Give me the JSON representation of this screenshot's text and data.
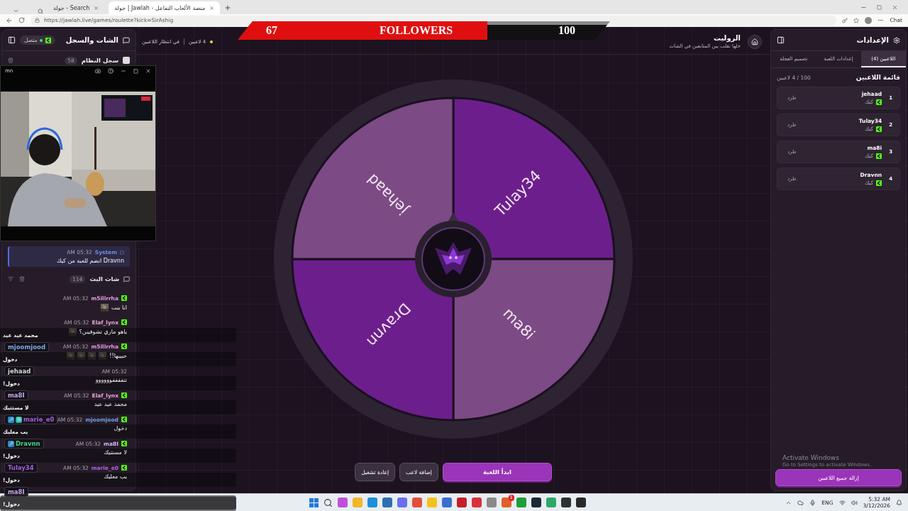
{
  "browser": {
    "tabs": [
      {
        "label": "جولة | Jawlah - منصة الألعاب التفاعل",
        "selected": true
      },
      {
        "label": "جولة - Search",
        "selected": false
      }
    ],
    "url": "https://jawlah.live/games/roulette?kick=SirAshig",
    "chat_button": "Chat"
  },
  "followers_bar": {
    "current": "67",
    "label": "FOLLOWERS",
    "goal": "100",
    "level": 0.67
  },
  "chat_panel": {
    "title": "الشات والسجل",
    "status": "متصل",
    "connected": true,
    "system_log": {
      "title": "سجل النظام",
      "count": "58",
      "messages": [
        {
          "sender": "System",
          "time": "AM 05:32",
          "text": "Dravnn انضم للعبة من كيك"
        }
      ]
    },
    "stream_chat": {
      "title": "شات البث",
      "count": "114",
      "messages": [
        {
          "user": "m5illrrha",
          "color": "#e59be8",
          "time": "AM 05:32",
          "text": "انا بنت"
        },
        {
          "user": "Elaf_lynx",
          "color": "#e7a6d9",
          "time": "AM 05:32",
          "text": "ياهو ماري تشوفينن؟"
        },
        {
          "user": "m5illrrha",
          "color": "#e59be8",
          "time": "AM 05:32",
          "text": "حبيبها!!"
        },
        {
          "time": "AM 05:32",
          "text": "تتففففوووووو"
        },
        {
          "user": "Elaf_lynx",
          "color": "#e7a6d9",
          "time": "AM 05:32",
          "text": "محمد عيد عيد"
        },
        {
          "user": "mjoomjood",
          "color": "#6f9fe0",
          "time": "AM 05:32",
          "text": "دخول"
        },
        {
          "user": "ma8I",
          "color": "#d9b8f5",
          "time": "AM 05:32",
          "text": "لا مستتيك"
        },
        {
          "user": "marie_e0",
          "color": "#b064e6",
          "time": "AM 05:32",
          "text": "يب معليك"
        }
      ]
    }
  },
  "camera_window": {
    "title": "mn",
    "kind": "picture"
  },
  "game": {
    "players_count": "4 لاعبين",
    "status": "في انتظار اللاعبين",
    "title": "الروليت",
    "subtitle": "خلها تقلب بين المتابعين في الشات",
    "wheel": [
      {
        "name": "Tulay34",
        "color": "#6c1f8c"
      },
      {
        "name": "ma8i",
        "color": "#7c4a84"
      },
      {
        "name": "Dravnn",
        "color": "#6c1f8c"
      },
      {
        "name": "jehaad",
        "color": "#7c4a84"
      }
    ],
    "buttons": [
      {
        "label": "ابدأ اللعبة",
        "kind": "primary"
      },
      {
        "label": "إضافة لاعب",
        "kind": "secondary"
      },
      {
        "label": "إعادة تشغيل",
        "kind": "secondary"
      }
    ]
  },
  "settings_panel": {
    "title": "الإعدادات",
    "tabs": [
      {
        "label": "اللاعبين (4)",
        "selected": true
      },
      {
        "label": "إعدادات اللعبة",
        "selected": false
      },
      {
        "label": "تصميم العجلة",
        "selected": false
      }
    ],
    "list_title": "قائمة اللاعبين",
    "list_count": "100 / 4 لاعبين",
    "players": [
      {
        "rank": "1",
        "name": "jehaad",
        "platform": "كيك",
        "action": "طرد"
      },
      {
        "rank": "2",
        "name": "Tulay34",
        "platform": "كيك",
        "action": "طرد"
      },
      {
        "rank": "3",
        "name": "ma8i",
        "platform": "كيك",
        "action": "طرد"
      },
      {
        "rank": "4",
        "name": "Dravnn",
        "platform": "كيك",
        "action": "طرد"
      }
    ],
    "clear_button": "إزالة جميع اللاعبين"
  },
  "os_notice": {
    "title": "Activate Windows",
    "text": "Go to Settings to activate Windows."
  },
  "chat_overlay": [
    {
      "text": "محمد عيد عيد"
    },
    {
      "user": "mjoomjood",
      "color": "#7aa7e6",
      "text": "دخول"
    },
    {
      "user": "jehaad",
      "color": "#d6d6d6",
      "text": "دخول!"
    },
    {
      "user": "ma8I",
      "color": "#c9a6ef",
      "text": "لا مستتيك"
    },
    {
      "user": "marie_e0",
      "color": "#a45de0",
      "badges": [
        {
          "kind": "wrench"
        },
        {
          "kind": "grid"
        }
      ],
      "text": "يب معليك"
    },
    {
      "user": "Dravnn",
      "color": "#45d483",
      "badges": [
        {
          "kind": "wrench"
        }
      ],
      "text": "دخول!"
    },
    {
      "user": "Tulay34",
      "color": "#a45de0",
      "text": "دخول!"
    },
    {
      "user": "ma8I",
      "color": "#c9a6ef",
      "text": "دخول!"
    }
  ],
  "taskbar": {
    "apps": [
      {
        "kind": "start"
      },
      {
        "kind": "search"
      },
      {
        "kind": "app",
        "color": "#c04fd8"
      },
      {
        "kind": "app",
        "color": "#f2b62b"
      },
      {
        "kind": "app",
        "color": "#1f8fd8"
      },
      {
        "kind": "app",
        "color": "#2f6fb0"
      },
      {
        "kind": "app",
        "color": "#6a6ff0"
      },
      {
        "kind": "app",
        "color": "#e0503a"
      },
      {
        "kind": "app",
        "color": "#f2c21b"
      },
      {
        "kind": "app",
        "color": "#3a6fd0"
      },
      {
        "kind": "app",
        "color": "#c81e2a"
      },
      {
        "kind": "app",
        "color": "#d8323a"
      },
      {
        "kind": "app",
        "color": "#8a8a8a"
      },
      {
        "kind": "app",
        "color": "#e0602a",
        "badge": "1"
      },
      {
        "kind": "app",
        "color": "#1f9e3a"
      },
      {
        "kind": "app",
        "color": "#1b2838"
      },
      {
        "kind": "app",
        "color": "#2ea86a"
      },
      {
        "kind": "app",
        "color": "#303030"
      },
      {
        "kind": "app",
        "color": "#2a2a2a"
      }
    ],
    "language": "ENG",
    "time": "5:32 AM",
    "date": "3/12/2026"
  }
}
